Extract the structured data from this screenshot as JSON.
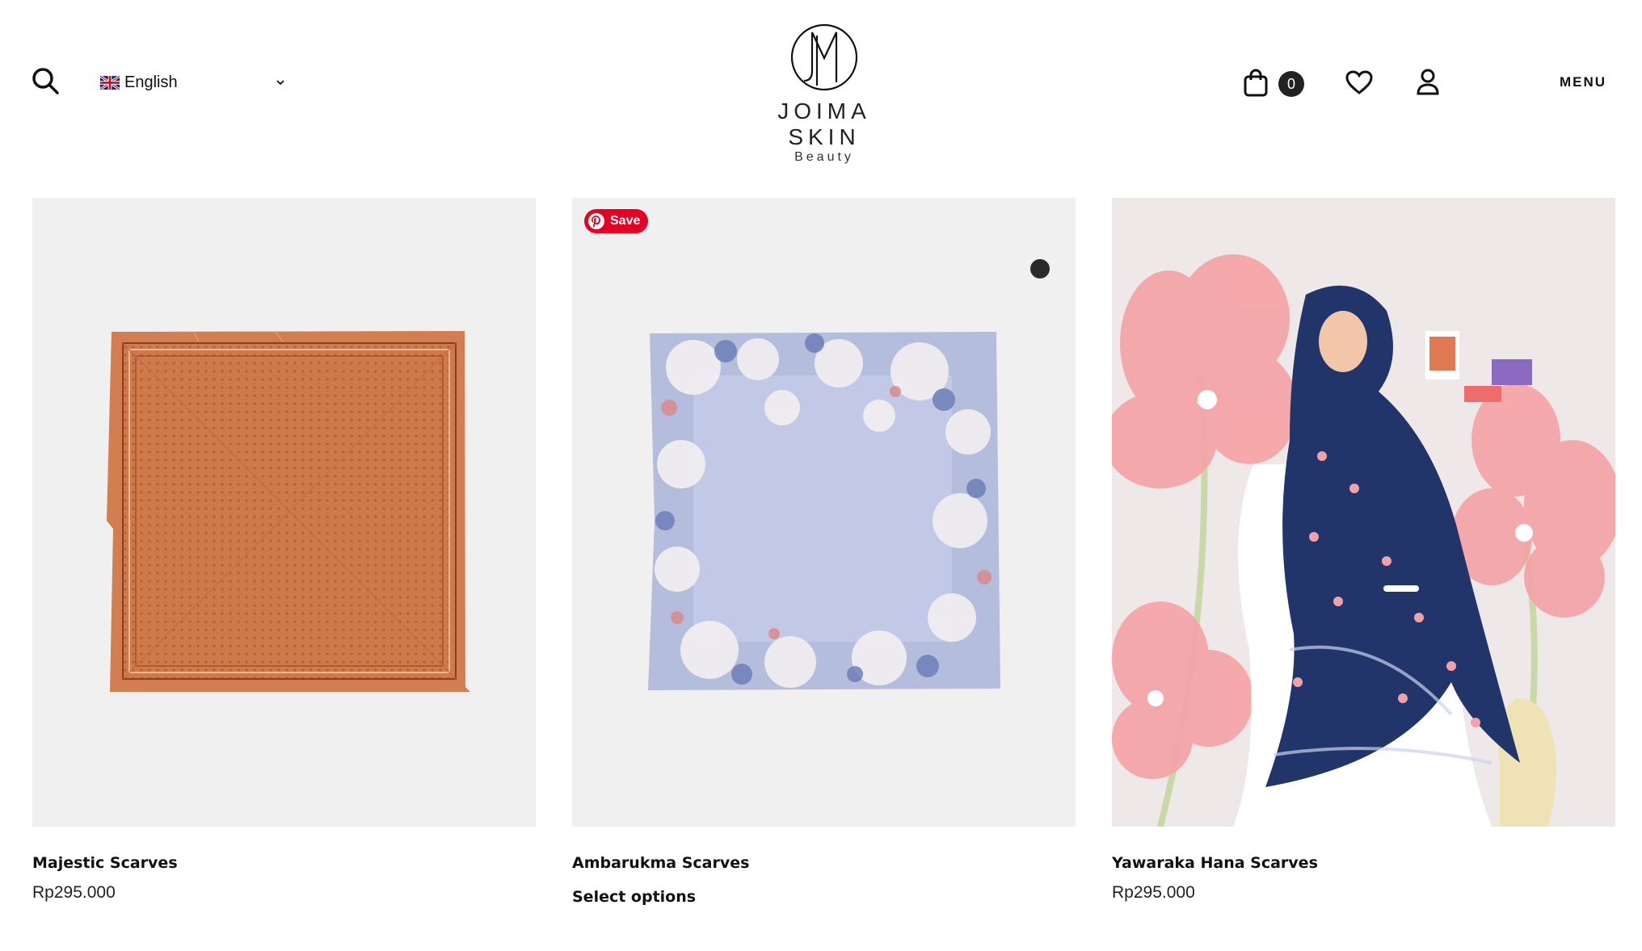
{
  "header": {
    "language": "English",
    "logo": {
      "name": "JOIMA SKIN",
      "sub": "Beauty"
    },
    "cart_count": "0",
    "menu_label": "MENU"
  },
  "icons": {
    "search": "search-icon",
    "flag": "uk-flag-icon",
    "chevron": "chevron-down-icon",
    "cart": "shopping-bag-icon",
    "wishlist": "heart-icon",
    "account": "user-icon",
    "pinterest": "pinterest-icon"
  },
  "colors": {
    "pinterest_red": "#e60023",
    "scarf_orange": "#d07a4c",
    "scarf_lavender": "#aab3d6",
    "hijab_navy": "#22356b",
    "flower_pink": "#f4a5a8"
  },
  "products": [
    {
      "title": "Majestic Scarves",
      "price": "Rp295.000"
    },
    {
      "title": "Ambarukma Scarves",
      "action": "Select options",
      "pin_label": "Save"
    },
    {
      "title": "Yawaraka Hana Scarves",
      "price": "Rp295.000"
    }
  ]
}
